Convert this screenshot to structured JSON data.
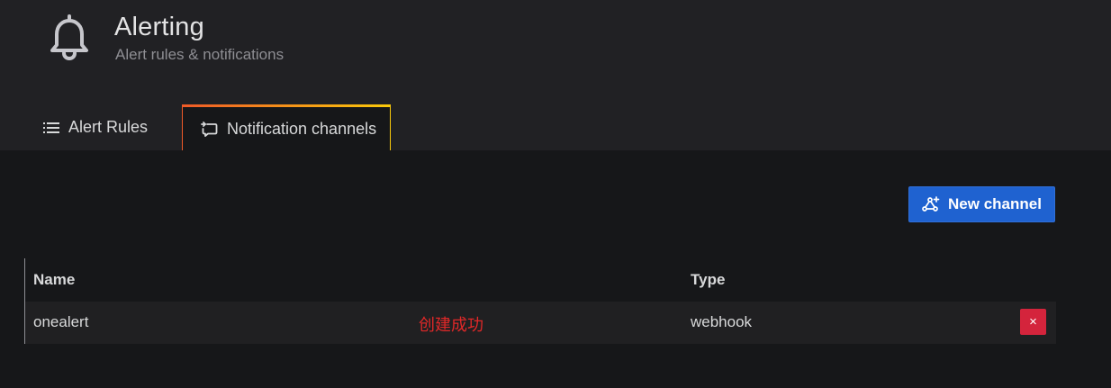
{
  "header": {
    "title": "Alerting",
    "subtitle": "Alert rules & notifications",
    "icon": "bell-icon"
  },
  "tabs": [
    {
      "label": "Alert Rules",
      "icon": "list-icon",
      "active": false
    },
    {
      "label": "Notification channels",
      "icon": "comment-alt-share-icon",
      "active": true
    }
  ],
  "toolbar": {
    "new_channel_label": "New channel",
    "new_channel_icon": "channel-add-icon"
  },
  "table": {
    "columns": [
      "Name",
      "Type"
    ],
    "rows": [
      {
        "name": "onealert",
        "type": "webhook",
        "delete_label": "×"
      }
    ]
  },
  "annotation": {
    "text": "创建成功",
    "color": "#e02828"
  },
  "colors": {
    "accent": "#1f62d0",
    "danger": "#d4243c",
    "tab_gradient_start": "#f05a28",
    "tab_gradient_end": "#fbca0a"
  }
}
